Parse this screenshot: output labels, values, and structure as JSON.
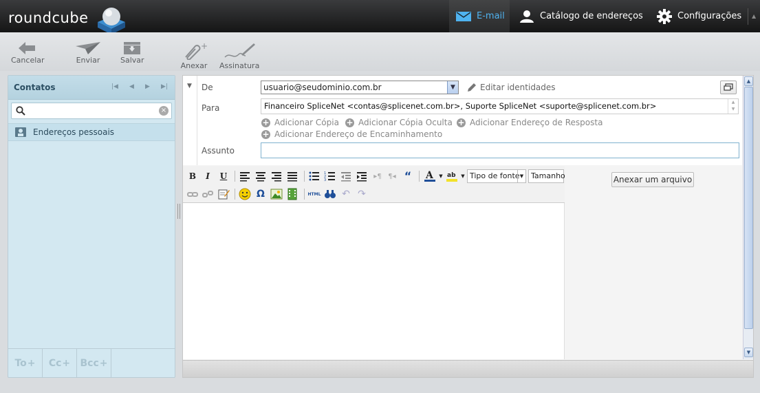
{
  "app": {
    "logo": "roundcube"
  },
  "topnav": {
    "mail": "E-mail",
    "addressbook": "Catálogo de endereços",
    "settings": "Configurações"
  },
  "toolbar": {
    "cancel": "Cancelar",
    "send": "Enviar",
    "save": "Salvar",
    "attach": "Anexar",
    "signature": "Assinatura"
  },
  "contacts": {
    "title": "Contatos",
    "addressbook_item": "Endereços pessoais",
    "footer": {
      "to": "To",
      "cc": "Cc",
      "bcc": "Bcc"
    }
  },
  "compose": {
    "from_label": "De",
    "from_value": "usuario@seudominio.com.br",
    "edit_identities": "Editar identidades",
    "to_label": "Para",
    "to_value": "Financeiro SpliceNet <contas@splicenet.com.br>, Suporte SpliceNet <suporte@splicenet.com.br>",
    "add_cc": "Adicionar Cópia",
    "add_bcc": "Adicionar Cópia Oculta",
    "add_replyto": "Adicionar Endereço de Resposta",
    "add_followupto": "Adicionar Endereço de Encaminhamento",
    "subject_label": "Assunto",
    "subject_value": "",
    "attach_file": "Anexar um arquivo"
  },
  "editor": {
    "bold": "B",
    "italic": "I",
    "underline": "U",
    "font_family": "Tipo de fonte",
    "font_size": "Tamanho",
    "html_label": "HTML"
  },
  "colors": {
    "accent": "#4fb3f0",
    "contacts_bg": "#d3e8f1"
  }
}
